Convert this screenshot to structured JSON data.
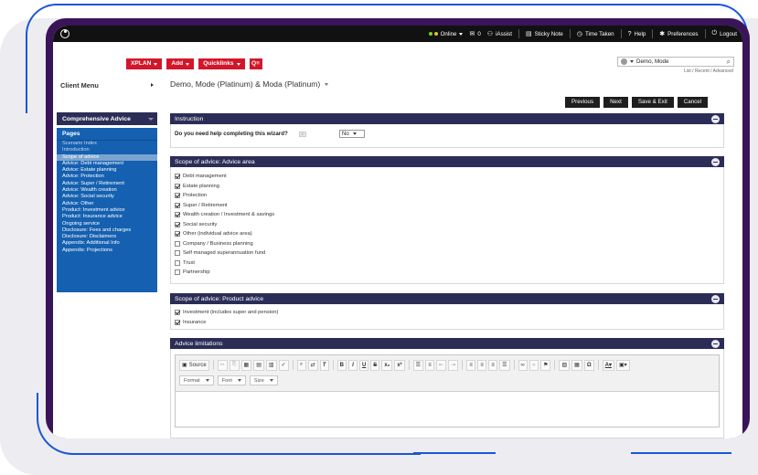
{
  "topbar": {
    "online": "Online",
    "mail_count": "0",
    "iassist": "iAssist",
    "sticky_note": "Sticky Note",
    "time_taken": "Time Taken",
    "help": "Help",
    "preferences": "Preferences",
    "logout": "Logout"
  },
  "menu": {
    "xplan": "XPLAN",
    "add": "Add",
    "quicklinks": "Quicklinks",
    "quicklinks_icon": "Q≡"
  },
  "client_search": {
    "value": "Demo, Mode",
    "links": "List / Recent / Advanced"
  },
  "sidebar": {
    "client_menu": "Client Menu",
    "section": "Comprehensive Advice",
    "pages_title": "Pages",
    "pages": [
      {
        "label": "Scenario Index",
        "state": "dim"
      },
      {
        "label": "Introduction",
        "state": "dim"
      },
      {
        "label": "Scope of advice",
        "state": "active"
      },
      {
        "label": "Advice: Debt management",
        "state": "normal"
      },
      {
        "label": "Advice: Estate planning",
        "state": "normal"
      },
      {
        "label": "Advice: Protection",
        "state": "normal"
      },
      {
        "label": "Advice: Super / Retirement",
        "state": "normal"
      },
      {
        "label": "Advice: Wealth creation",
        "state": "normal"
      },
      {
        "label": "Advice: Social security",
        "state": "normal"
      },
      {
        "label": "Advice: Other",
        "state": "normal"
      },
      {
        "label": "Product: Investment advice",
        "state": "normal"
      },
      {
        "label": "Product: Insurance advice",
        "state": "normal"
      },
      {
        "label": "Ongoing service",
        "state": "normal"
      },
      {
        "label": "Disclosure: Fees and charges",
        "state": "normal"
      },
      {
        "label": "Disclosure: Disclaimers",
        "state": "normal"
      },
      {
        "label": "Appendix: Additional Info",
        "state": "normal"
      },
      {
        "label": "Appendix: Projections",
        "state": "normal"
      }
    ]
  },
  "main": {
    "client_title": "Demo, Mode (Platinum) & Moda (Platinum)",
    "buttons": {
      "previous": "Previous",
      "next": "Next",
      "save_exit": "Save & Exit",
      "cancel": "Cancel"
    },
    "instruction": {
      "title": "Instruction",
      "question": "Do you need help completing this wizard?",
      "answer": "No"
    },
    "advice_area": {
      "title": "Scope of advice: Advice area",
      "items": [
        {
          "label": "Debt management",
          "checked": true
        },
        {
          "label": "Estate planning",
          "checked": true
        },
        {
          "label": "Protection",
          "checked": true
        },
        {
          "label": "Super / Retirement",
          "checked": true
        },
        {
          "label": "Wealth creation / Investment & savings",
          "checked": true
        },
        {
          "label": "Social security",
          "checked": true
        },
        {
          "label": "Other (individual advice area)",
          "checked": true
        },
        {
          "label": "Company / Business planning",
          "checked": false
        },
        {
          "label": "Self managed superannuation fund",
          "checked": false
        },
        {
          "label": "Trust",
          "checked": false
        },
        {
          "label": "Partnership",
          "checked": false
        }
      ]
    },
    "product_advice": {
      "title": "Scope of advice: Product advice",
      "items": [
        {
          "label": "Investment (includes super and pension)",
          "checked": true
        },
        {
          "label": "Insurance",
          "checked": true
        }
      ]
    },
    "advice_limitations": {
      "title": "Advice limitations",
      "source_label": "Source",
      "format_label": "Format",
      "font_label": "Font",
      "size_label": "Size"
    }
  }
}
